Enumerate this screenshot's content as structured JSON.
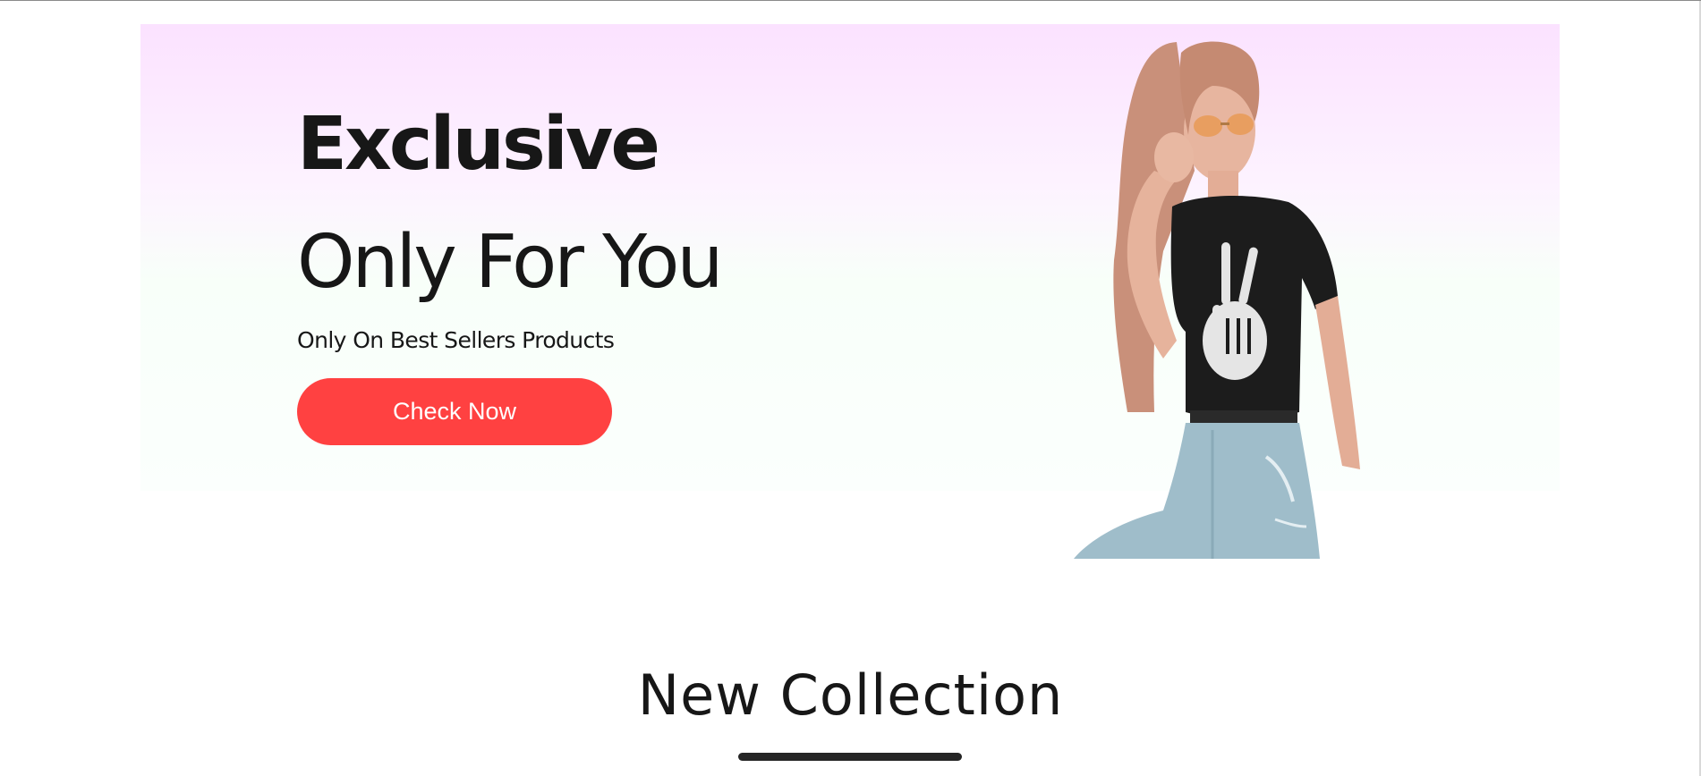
{
  "hero": {
    "title_line1": "Exclusive",
    "title_line2": "Only For You",
    "subtitle": "Only On Best Sellers Products",
    "button_label": "Check Now",
    "button_color": "#ff4141"
  },
  "hero_image": {
    "icon": "model-photo"
  },
  "collection": {
    "title": "New Collection"
  },
  "colors": {
    "banner_top": "#fbe2ff",
    "banner_bottom": "#fbfffd",
    "text": "#171717",
    "underline": "#252525"
  }
}
